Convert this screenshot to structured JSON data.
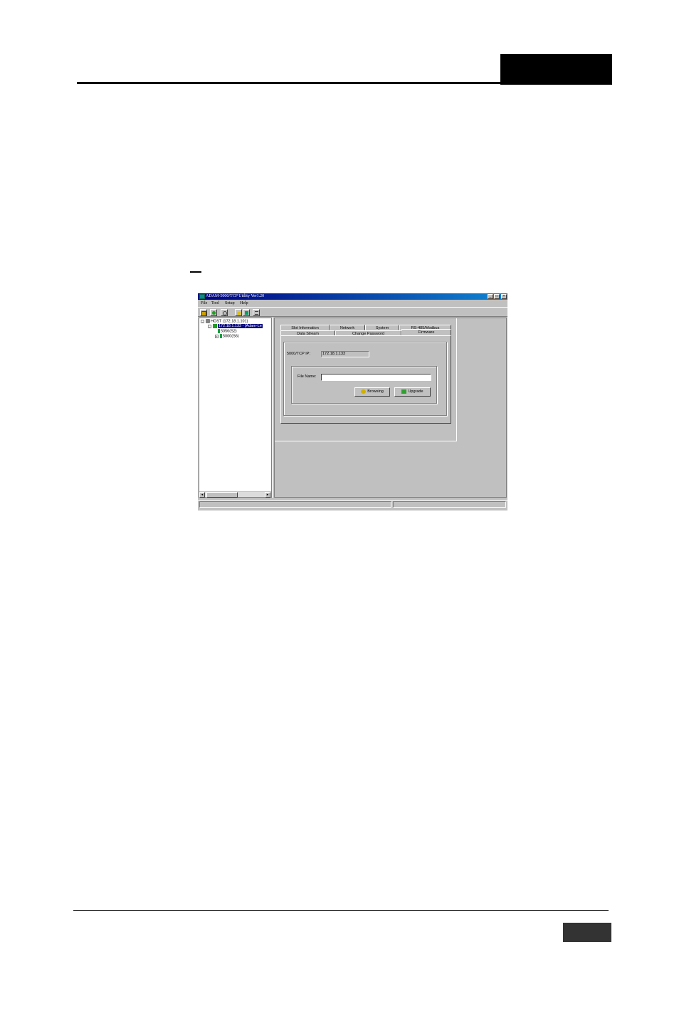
{
  "window": {
    "title": "ADAM-5000/TCP Utility Ver1.20",
    "menu": [
      "File",
      "Tool",
      "Setup",
      "Help"
    ],
    "controls": {
      "minimize": "_",
      "maximize": "□",
      "close": "×"
    }
  },
  "toolbar": {
    "icons": [
      "exit-icon",
      "search-icon",
      "zoom-icon",
      "open-folder-icon",
      "save-icon",
      "terminal-icon"
    ]
  },
  "tree": {
    "host": "HOST (172.18.1.101)",
    "device": "172.18.1.133 - [Adam-Le",
    "modules": [
      "5056(S2)",
      "5000(S6)"
    ]
  },
  "tabs": {
    "row1": [
      "Slot Information",
      "Network",
      "System",
      "RS-485/Modbus"
    ],
    "row2": [
      "Data Stream",
      "Change Password",
      "Firmware"
    ],
    "active": "Firmware"
  },
  "firmware": {
    "ip_label": "5000/TCP IP:",
    "ip_value": "172.18.1.133",
    "file_label": "File Name:",
    "file_value": "",
    "browse_label": "Browsing",
    "upgrade_label": "Upgrade"
  },
  "colors": {
    "titlebar": "#000080",
    "selection": "#000080",
    "face": "#c0c0c0"
  }
}
